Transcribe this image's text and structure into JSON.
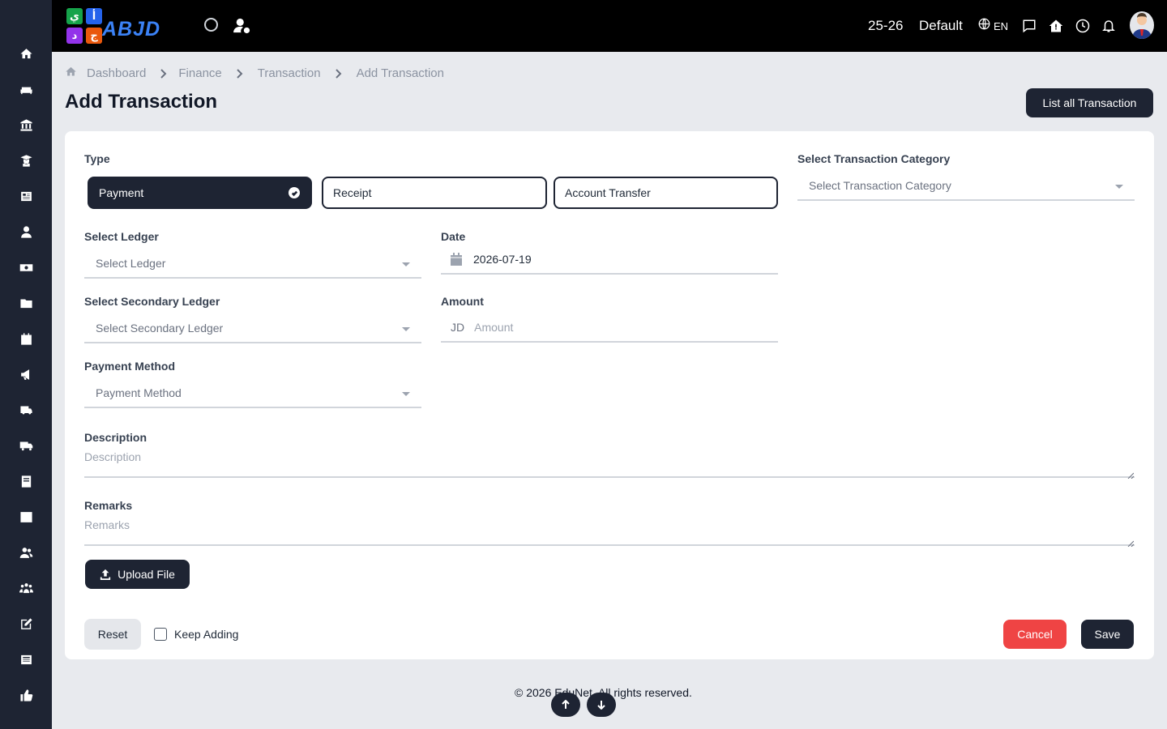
{
  "app": {
    "logo_text": "ABJD",
    "logo_blocks": [
      "ي",
      "أ",
      "د",
      "ج"
    ],
    "session": "25-26",
    "profile": "Default",
    "language": "EN"
  },
  "sidebar": {
    "icons": [
      "home-icon",
      "sofa-icon",
      "bank-icon",
      "graduate-icon",
      "newspaper-icon",
      "user-icon",
      "money-icon",
      "folder-icon",
      "calendar-icon",
      "megaphone-icon",
      "school-bus-icon",
      "truck-icon",
      "book-icon",
      "image-icon",
      "users-icon",
      "group-icon",
      "edit-icon",
      "news-icon",
      "thumbs-up-icon"
    ]
  },
  "breadcrumb": {
    "items": [
      "Dashboard",
      "Finance",
      "Transaction",
      "Add Transaction"
    ]
  },
  "page": {
    "title": "Add Transaction",
    "list_button": "List all Transaction"
  },
  "form": {
    "type_label": "Type",
    "types": [
      "Payment",
      "Receipt",
      "Account Transfer"
    ],
    "selected_type": "Payment",
    "category_label": "Select Transaction Category",
    "category_placeholder": "Select Transaction Category",
    "ledger_label": "Select Ledger",
    "ledger_placeholder": "Select Ledger",
    "date_label": "Date",
    "date_value": "2026-07-19",
    "secondary_ledger_label": "Select Secondary Ledger",
    "secondary_ledger_placeholder": "Select Secondary Ledger",
    "amount_label": "Amount",
    "amount_prefix": "JD",
    "amount_placeholder": "Amount",
    "payment_method_label": "Payment Method",
    "payment_method_placeholder": "Payment Method",
    "description_label": "Description",
    "description_placeholder": "Description",
    "remarks_label": "Remarks",
    "remarks_placeholder": "Remarks",
    "upload_label": "Upload File",
    "reset_label": "Reset",
    "keep_adding_label": "Keep Adding",
    "cancel_label": "Cancel",
    "save_label": "Save"
  },
  "footer": {
    "text": "© 2026 EduNet. All rights reserved."
  },
  "colors": {
    "sidebar": "#1e2433",
    "topbar": "#000000",
    "primary": "#1e2433",
    "danger": "#ef4444",
    "background": "#e8eaee"
  }
}
